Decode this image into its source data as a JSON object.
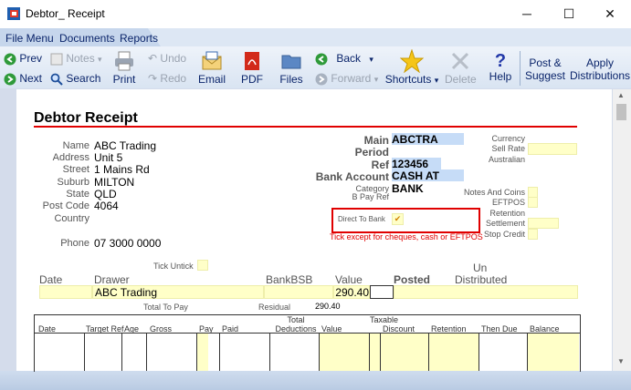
{
  "window": {
    "title": "Debtor_ Receipt",
    "minimize": "─",
    "maximize": "☐",
    "close": "✕"
  },
  "menu": [
    "File Menu",
    "Documents",
    "Reports"
  ],
  "toolbar": {
    "prev": "Prev",
    "next": "Next",
    "notes": "Notes",
    "search": "Search",
    "undo": "Undo",
    "redo": "Redo",
    "print": "Print",
    "email": "Email",
    "pdf": "PDF",
    "files": "Files",
    "back": "Back",
    "forward": "Forward",
    "shortcuts": "Shortcuts",
    "delete": "Delete",
    "help": "Help",
    "post_suggest_1": "Post &",
    "post_suggest_2": "Suggest",
    "apply_1": "Apply",
    "apply_2": "Distributions"
  },
  "doc": {
    "heading": "Debtor Receipt",
    "name_label": "Name",
    "name": "ABC Trading",
    "address_label": "Address",
    "address": "Unit 5",
    "street_label": "Street",
    "street": "1 Mains Rd",
    "suburb_label": "Suburb",
    "suburb": "MILTON",
    "state_label": "State",
    "state": "QLD",
    "postcode_label": "Post Code",
    "postcode": "4064",
    "country_label": "Country",
    "phone_label": "Phone",
    "phone": "07 3000 0000",
    "main_label": "Main",
    "main": "ABCTRA",
    "period_label": "Period",
    "ref_label": "Ref",
    "ref": "123456",
    "bank_account_label": "Bank Account",
    "bank_account": "CASH AT BANK",
    "category_label": "Category",
    "bpay_ref_label": "B Pay Ref",
    "currency_label": "Currency",
    "sell_rate_label": "Sell Rate",
    "australian_label": "Australian",
    "notes_coins_label": "Notes And Coins",
    "eftpos_label": "EFTPOS",
    "retention_label": "Retention",
    "settlement_label": "Settlement",
    "stop_credit_label": "Stop Credit",
    "direct_to_bank_label": "Direct To Bank",
    "direct_to_bank_check": "✔",
    "tick_note": "Tick except for cheques, cash or EFTPOS",
    "tick_untick_label": "Tick Untick",
    "date_label": "Date",
    "drawer_label": "Drawer",
    "bankbsb_label": "BankBSB",
    "value_label": "Value",
    "posted_label": "Posted",
    "un_label": "Un",
    "distributed_label": "Distributed",
    "drawer_value": "ABC Trading",
    "value": "290.40",
    "total_to_pay_label": "Total To Pay",
    "residual_label": "Residual",
    "residual": "290.40"
  },
  "grid": {
    "columns": [
      "Date",
      "Target Ref",
      "Age",
      "Gross",
      "Pay",
      "Paid",
      "Total Deductions",
      "Value",
      "Taxable",
      "Discount",
      "Retention",
      "Then Due",
      "Balance"
    ]
  },
  "colors": {
    "heading_underline": "#e00000",
    "field_yellow": "#ffffc8",
    "field_blue": "#c6dcf7",
    "note_red": "#e00000"
  }
}
